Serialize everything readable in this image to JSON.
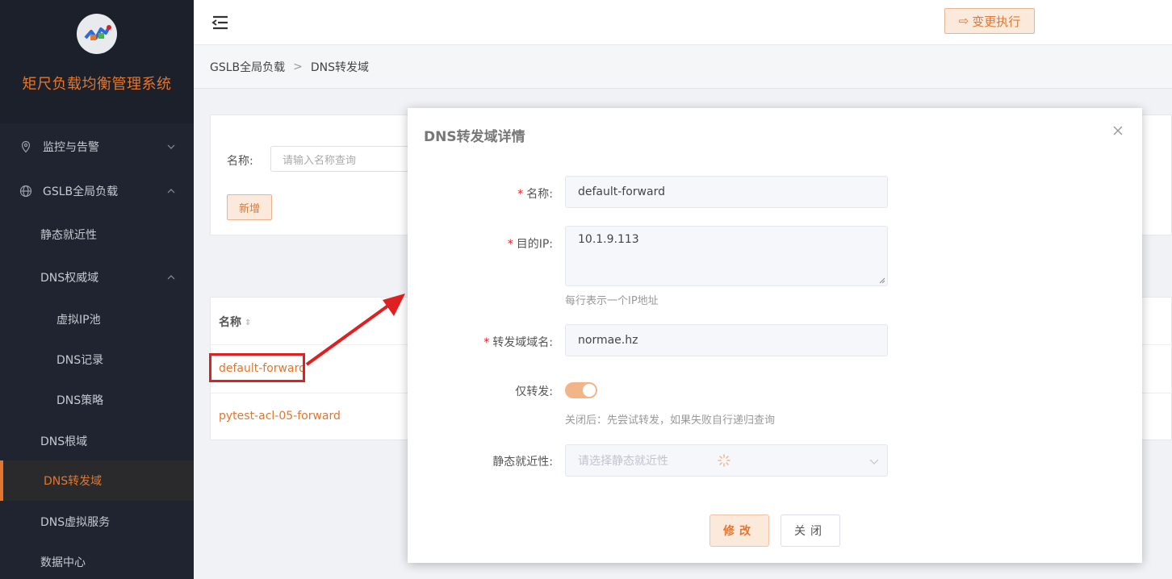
{
  "app": {
    "title": "矩尺负载均衡管理系统"
  },
  "colors": {
    "accent": "#e2762f",
    "sidebar_bg": "#1f2430",
    "highlight": "#e02020"
  },
  "header": {
    "exec_label": "变更执行"
  },
  "sidebar": {
    "items": [
      {
        "label": "监控与告警",
        "icon": "location-pin-icon"
      },
      {
        "label": "GSLB全局负载",
        "icon": "globe-icon"
      },
      {
        "label": "静态就近性"
      },
      {
        "label": "DNS权威域"
      },
      {
        "label": "虚拟IP池"
      },
      {
        "label": "DNS记录"
      },
      {
        "label": "DNS策略"
      },
      {
        "label": "DNS根域"
      },
      {
        "label": "DNS转发域"
      },
      {
        "label": "DNS虚拟服务"
      },
      {
        "label": "数据中心"
      }
    ]
  },
  "breadcrumb": {
    "items": [
      "GSLB全局负载",
      "DNS转发域"
    ]
  },
  "search": {
    "label": "名称:",
    "placeholder": "请输入名称查询",
    "add_label": "新增"
  },
  "table": {
    "header_name": "名称",
    "rows": [
      {
        "name": "default-forward"
      },
      {
        "name": "pytest-acl-05-forward"
      }
    ]
  },
  "modal": {
    "title": "DNS转发域详情",
    "fields": {
      "name": {
        "label": "名称:",
        "value": "default-forward"
      },
      "dest_ip": {
        "label": "目的IP:",
        "value": "10.1.9.113",
        "help": "每行表示一个IP地址"
      },
      "forward_domain": {
        "label": "转发域域名:",
        "value": "normae.hz"
      },
      "forward_only": {
        "label": "仅转发:",
        "enabled": true,
        "help": "关闭后：先尝试转发，如果失败自行递归查询"
      },
      "static_proximity": {
        "label": "静态就近性:",
        "placeholder": "请选择静态就近性"
      }
    },
    "edit_label": "修改",
    "close_label": "关闭"
  }
}
